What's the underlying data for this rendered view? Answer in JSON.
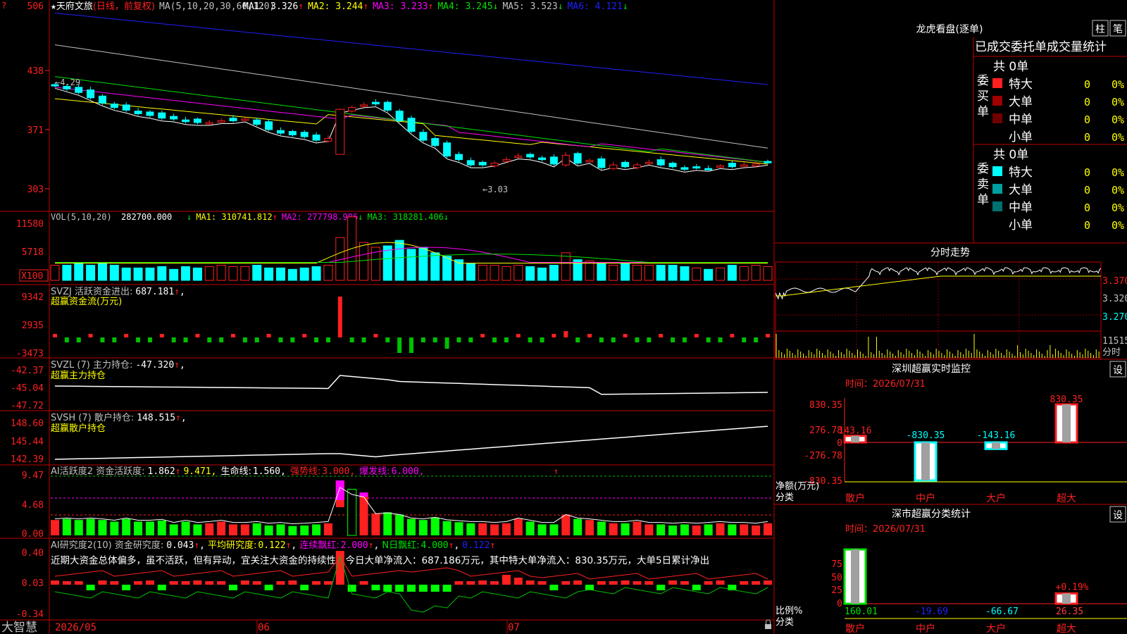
{
  "colors": {
    "up": "#ff2020",
    "down": "#00ffff",
    "frame": "#c00000",
    "white": "#ffffff",
    "yellow": "#ffff00",
    "magenta": "#ff00ff",
    "green": "#00e000",
    "blue": "#2020ff",
    "grey": "#c0c0c0",
    "label": "#ff4040"
  },
  "main": {
    "title_left": "天府文旅",
    "title_paren": "(日线，前复权)",
    "title_ma": "MA(5,10,20,30,60,120)",
    "ma_items": [
      {
        "label": "MA1:",
        "value": "3.326",
        "arrow": "↑",
        "color": "#ffffff"
      },
      {
        "label": "MA2:",
        "value": "3.244",
        "arrow": "↑",
        "color": "#ffff00"
      },
      {
        "label": "MA3:",
        "value": "3.233",
        "arrow": "↑",
        "color": "#ff00ff"
      },
      {
        "label": "MA4:",
        "value": "3.245",
        "arrow": "↓",
        "color": "#00e000"
      },
      {
        "label": "MA5:",
        "value": "3.523",
        "arrow": "↓",
        "color": "#c0c0c0"
      },
      {
        "label": "MA6:",
        "value": "4.121",
        "arrow": "↓",
        "color": "#2020ff"
      }
    ],
    "y_ticks": [
      "506",
      "438",
      "371",
      "303"
    ],
    "y_values": [
      5.06,
      4.38,
      3.71,
      3.03
    ],
    "hi_label": "←4.29",
    "lo_label": "←3.03",
    "x_labels": [
      "2026/05",
      "06",
      "07"
    ]
  },
  "vol": {
    "title": "VOL(5,10,20)",
    "value": "282700.000",
    "items": [
      {
        "label": "MA1:",
        "value": "310741.812",
        "arrow": "↑",
        "color": "#ffff00"
      },
      {
        "label": "MA2:",
        "value": "277798.906",
        "arrow": "↓",
        "color": "#ff00ff"
      },
      {
        "label": "MA3:",
        "value": "318281.406",
        "arrow": "↓",
        "color": "#00e000"
      }
    ],
    "y_ticks": [
      "11580",
      "5718"
    ],
    "unit": "X100"
  },
  "svzj": {
    "title": "SVZJ  活跃资金进出:",
    "value": "687.181",
    "arrow": "↑",
    "sub": "超赢资金流(万元)",
    "y_ticks": [
      "9342",
      "2935",
      "-3473"
    ]
  },
  "svzl": {
    "title": "SVZL (7) 主力持仓:",
    "value": "-47.320",
    "arrow": "↑",
    "sub": "超赢主力持仓",
    "y_ticks": [
      "-42.37",
      "-45.04",
      "-47.72"
    ]
  },
  "svsh": {
    "title": "SVSH (7) 散户持仓:",
    "value": "148.515",
    "arrow": "↑",
    "sub": "超赢散户持仓",
    "y_ticks": [
      "148.60",
      "145.44",
      "142.39"
    ]
  },
  "ai1": {
    "title": "AI活跃度2 资金活跃度:",
    "v1": "1.862",
    "a1": "↑",
    "v2": "9.471,",
    "l3": "生命线:",
    "v3": "1.560,",
    "l4": "强势线:",
    "v4": "3.000,",
    "l5": "爆发线:",
    "v5": "6.000,",
    "y_ticks": [
      "9.47",
      "4.68",
      "0.00"
    ]
  },
  "ai2": {
    "title": "AI研究度2(10) 资金研究度:",
    "v1": "0.043",
    "a1": "↑",
    "l2": "平均研究度:",
    "v2": "0.122",
    "a2": "↑",
    "l3": "连续飘红:",
    "v3": "2.000",
    "a3": "↑",
    "l4": "N日飘红:",
    "v4": "4.000",
    "a4": "↑",
    "v5": "0.122",
    "a5": "↑",
    "comment": "近期大资金总体偏多，虽不活跃，但有异动，宜关注大资金的持续性，今日大单净流入：687.186万元，其中特大单净流入：830.35万元，大单5日累计净出",
    "y_ticks": [
      "0.40",
      "0.03",
      "-0.34"
    ]
  },
  "footer": {
    "brand": "大智慧"
  },
  "right": {
    "tab_labels": [
      "柱",
      "笔"
    ],
    "lhb_title": "龙虎看盘(逐单)",
    "stat_tabs": [
      "已成交",
      "委托单",
      "成交量统计"
    ],
    "buy": {
      "side_label": "委买单",
      "total": "共 0单",
      "rows": [
        {
          "label": "特大",
          "value": "0",
          "pct": "0%",
          "color": "#ff2020"
        },
        {
          "label": "大单",
          "value": "0",
          "pct": "0%",
          "color": "#a00000"
        },
        {
          "label": "中单",
          "value": "0",
          "pct": "0%",
          "color": "#700000"
        },
        {
          "label": "小单",
          "value": "0",
          "pct": "0%",
          "color": ""
        }
      ]
    },
    "sell": {
      "side_label": "委卖单",
      "total": "共 0单",
      "rows": [
        {
          "label": "特大",
          "value": "0",
          "pct": "0%",
          "color": "#00ffff"
        },
        {
          "label": "大单",
          "value": "0",
          "pct": "0%",
          "color": "#00a0a0"
        },
        {
          "label": "中单",
          "value": "0",
          "pct": "0%",
          "color": "#007070"
        },
        {
          "label": "小单",
          "value": "0",
          "pct": "0%",
          "color": ""
        }
      ]
    },
    "intraday": {
      "title": "分时走势",
      "y_ticks": [
        "3.370",
        "3.320",
        "3.270"
      ],
      "vol_tick": "11515",
      "vol_label": "分时"
    },
    "sz_monitor": {
      "title": "深圳超赢实时监控",
      "settings": "设",
      "time_label": "时间：2026/07/31",
      "y_ticks": [
        "830.35",
        "276.78",
        "0",
        "-276.78",
        "-830.35"
      ],
      "ylabel": "净额(万元)",
      "xlabel": "分类",
      "categories": [
        "散户",
        "中户",
        "大户",
        "超大"
      ],
      "values": [
        143.16,
        -830.35,
        -143.16,
        830.35
      ],
      "value_labels": [
        "143.16",
        "-830.35",
        "-143.16",
        "830.35"
      ]
    },
    "sz_stats": {
      "title": "深市超赢分类统计",
      "settings": "设",
      "time_label": "时间：2026/07/31",
      "y_ticks": [
        "75",
        "50",
        "25",
        "0"
      ],
      "ylabel": "比例%",
      "xlabel": "分类",
      "categories": [
        "散户",
        "中户",
        "大户",
        "超大"
      ],
      "bars": [
        100,
        0,
        0,
        19
      ],
      "bar_labels": [
        "",
        "",
        "",
        "+0.19%"
      ],
      "values": [
        "160.01",
        "-19.69",
        "-66.67",
        "26.35"
      ],
      "value_colors": [
        "#00e000",
        "#2020ff",
        "#00ffff",
        "#ff4040"
      ]
    }
  }
}
